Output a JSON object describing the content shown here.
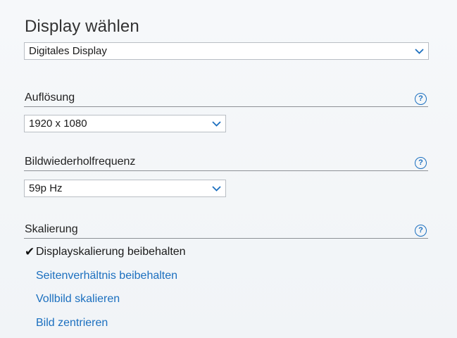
{
  "page_title": "Display wählen",
  "display_select": {
    "value": "Digitales Display"
  },
  "resolution": {
    "label": "Auflösung",
    "value": "1920 x 1080"
  },
  "refresh_rate": {
    "label": "Bildwiederholfrequenz",
    "value": "59p Hz"
  },
  "scaling": {
    "label": "Skalierung",
    "check_glyph": "✔",
    "options": [
      {
        "label": "Displayskalierung beibehalten",
        "selected": true
      },
      {
        "label": "Seitenverhältnis beibehalten",
        "selected": false
      },
      {
        "label": "Vollbild skalieren",
        "selected": false
      },
      {
        "label": "Bild zentrieren",
        "selected": false
      }
    ]
  },
  "help_glyph": "?",
  "icons": {
    "dropdown": "chevron-down-icon",
    "help": "help-icon",
    "check": "checkmark-icon"
  },
  "colors": {
    "accent": "#1b6fbf",
    "divider": "#8d9196",
    "background": "#f4f6f8"
  }
}
